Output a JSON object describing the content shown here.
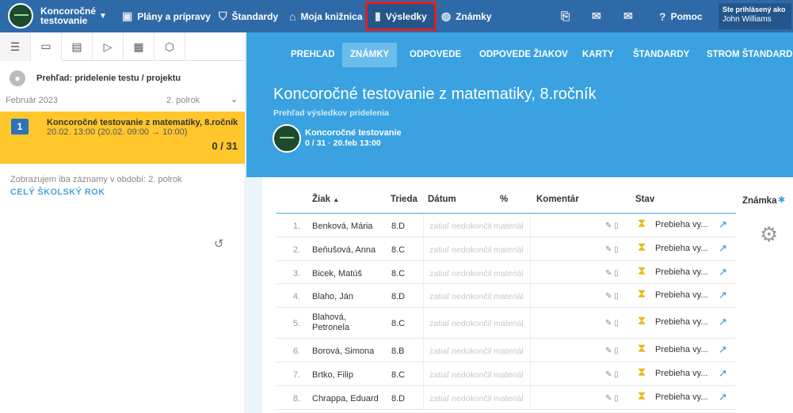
{
  "topbar": {
    "brand": "Koncoročné testovanie",
    "nav": [
      "Plány a prípravy",
      "Štandardy",
      "Moja knižnica",
      "Výsledky",
      "Známky"
    ],
    "help": "Pomoc",
    "user_label": "Ste prihlásený ako",
    "user_name": "John Williams",
    "highlight_color": "#e02020"
  },
  "left": {
    "overview": "Prehľad: pridelenie testu / projektu",
    "month": "Február 2023",
    "semester": "2. polrok",
    "card": {
      "number": "1",
      "title": "Koncoročné testovanie z matematiky, 8.ročník",
      "subtitle": "20.02. 13:00 (20.02. 09:00 → 10:00)",
      "count": "0 / 31",
      "color": "#ffc72c"
    },
    "filter_note": "Zobrazujem iba záznamy v období: 2. polrok",
    "filter_link": "CELÝ ŠKOLSKÝ ROK"
  },
  "subnav": [
    "PREHĽAD",
    "ZNÁMKY",
    "ODPOVEDE",
    "ODPOVEDE ŽIAKOV",
    "KARTY",
    "ŠTANDARDY",
    "STROM ŠTANDARDOV"
  ],
  "hero": {
    "title": "Koncoročné testovanie z matematiky, 8.ročník",
    "subtitle": "Prehľad výsledkov pridelenia",
    "test_name": "Koncoročné testovanie",
    "test_meta": "0 / 31 · 20.feb 13:00"
  },
  "table": {
    "headers": {
      "student": "Žiak",
      "class": "Trieda",
      "date": "Dátum",
      "percent": "%",
      "comment": "Komentár",
      "status": "Stav",
      "grade": "Známka"
    },
    "rows": [
      {
        "num": "1.",
        "name": "Benková, Mária",
        "cls": "8.D",
        "date": "zatiaľ nedokončil materiál",
        "status": "Prebieha vy..."
      },
      {
        "num": "2.",
        "name": "Beňušová, Anna",
        "cls": "8.C",
        "date": "zatiaľ nedokončil materiál",
        "status": "Prebieha vy..."
      },
      {
        "num": "3.",
        "name": "Bicek, Matúš",
        "cls": "8.C",
        "date": "zatiaľ nedokončil materiál",
        "status": "Prebieha vy..."
      },
      {
        "num": "4.",
        "name": "Blaho, Ján",
        "cls": "8.D",
        "date": "zatiaľ nedokončil materiál",
        "status": "Prebieha vy..."
      },
      {
        "num": "5.",
        "name": "Blahová, Petronela",
        "cls": "8.C",
        "date": "zatiaľ nedokončil materiál",
        "status": "Prebieha vy..."
      },
      {
        "num": "6.",
        "name": "Borová, Simona",
        "cls": "8.B",
        "date": "zatiaľ nedokončil materiál",
        "status": "Prebieha vy..."
      },
      {
        "num": "7.",
        "name": "Brtko, Filip",
        "cls": "8.C",
        "date": "zatiaľ nedokončil materiál",
        "status": "Prebieha vy..."
      },
      {
        "num": "8.",
        "name": "Chrappa, Eduard",
        "cls": "8.D",
        "date": "zatiaľ nedokončil materiál",
        "status": "Prebieha vy..."
      }
    ]
  }
}
